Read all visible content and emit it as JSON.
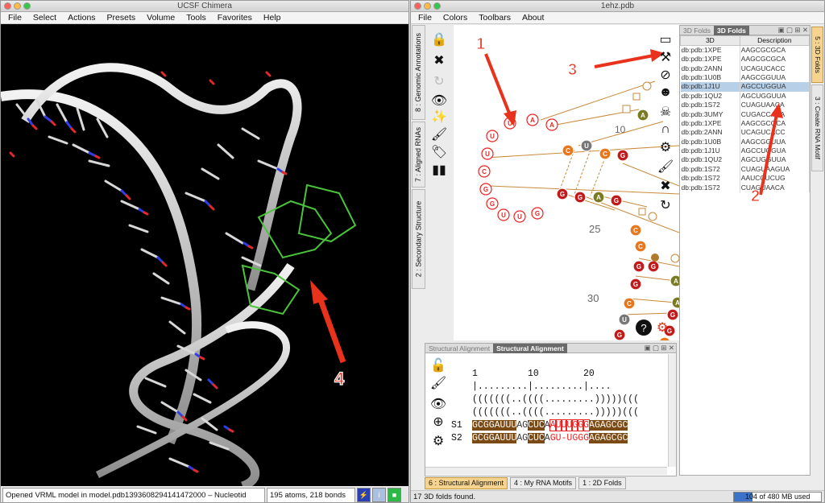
{
  "chimera": {
    "title": "UCSF Chimera",
    "menu": [
      "File",
      "Select",
      "Actions",
      "Presets",
      "Volume",
      "Tools",
      "Favorites",
      "Help"
    ],
    "status": "Opened VRML model in model.pdb1393608294141472000 – Nucleotid",
    "atoms": "195 atoms, 218 bonds"
  },
  "annotations": {
    "a1": "1",
    "a2": "2",
    "a3": "3",
    "a4": "4"
  },
  "assemble": {
    "title": "1ehz.pdb",
    "menu": [
      "File",
      "Colors",
      "Toolbars",
      "About"
    ],
    "left_tabs": [
      "8 : Genomic Annotations",
      "7 : Aligned RNAs",
      "2 : Secondary Structure"
    ],
    "right_tabs": [
      "5 : 3D Folds",
      "3 : Create RNA Motif"
    ],
    "folds_panel": {
      "tab_inactive": "3D Folds",
      "tab_active": "3D Folds",
      "col_3d": "3D",
      "col_desc": "Description",
      "rows": [
        [
          "db:pdb:1XPE",
          "AAGCGCGCA"
        ],
        [
          "db:pdb:1XPE",
          "AAGCGCGCA"
        ],
        [
          "db:pdb:2ANN",
          "UCAGUCACC"
        ],
        [
          "db:pdb:1U0B",
          "AAGCGGUUA"
        ],
        [
          "db:pdb:1J1U",
          "AGCCUGGUA"
        ],
        [
          "db:pdb:1QU2",
          "AGCUGGUUA"
        ],
        [
          "db:pdb:1S72",
          "CUAGUAACA"
        ],
        [
          "db:pdb:3UMY",
          "CUGACCAUA"
        ],
        [
          "db:pdb:1XPE",
          "AAGCGCGCA"
        ],
        [
          "db:pdb:2ANN",
          "UCAGUCACC"
        ],
        [
          "db:pdb:1U0B",
          "AAGCGGUUA"
        ],
        [
          "db:pdb:1J1U",
          "AGCCUGGUA"
        ],
        [
          "db:pdb:1QU2",
          "AGCUGGUUA"
        ],
        [
          "db:pdb:1S72",
          "CUAGUAAGUA"
        ],
        [
          "db:pdb:1S72",
          "AAUCCUCUG"
        ],
        [
          "db:pdb:1S72",
          "CUAGUAACA"
        ]
      ]
    },
    "structure": {
      "labels": [
        "10",
        "25",
        "30"
      ],
      "loop_nts": [
        "U",
        "A",
        "A",
        "U",
        "U",
        "C",
        "G",
        "G",
        "U",
        "U",
        "G",
        "U",
        "A",
        "C",
        "A"
      ],
      "stem_nts": [
        "C",
        "U",
        "C",
        "G",
        "A",
        "G",
        "G",
        "A",
        "G",
        "C",
        "C",
        "G",
        "G",
        "C",
        "U",
        "G",
        "A",
        "A",
        "G",
        "G",
        "C",
        "G",
        "U",
        "A",
        "G"
      ]
    },
    "align_panel": {
      "tab_inactive": "Structural Alignment",
      "tab_active": "Structural Alignment",
      "ruler": "1         10        20",
      "ticks": "|.........|.........|....",
      "dots1": "(((((((..((((.........)))))(((",
      "dots2": "(((((((..((((.........)))))(((",
      "s1_label": "S1",
      "s2_label": "S2",
      "s1": "GCGGAUUUAGCUCAAUUUGGGAGAGCGC",
      "s2": "GCGGAUUUAGCUCAGU-UGGGAGAGCGC"
    },
    "bottom_tabs": [
      "6 : Structural Alignment",
      "4 : My RNA Motifs",
      "1 : 2D Folds"
    ],
    "status": "17 3D folds found.",
    "memory": "104 of 480 MB used",
    "memory_fraction": 0.217
  },
  "colors": {
    "accent": "#f6d38f",
    "arrow": "#e8321c",
    "selection": "#b8cfe8"
  }
}
